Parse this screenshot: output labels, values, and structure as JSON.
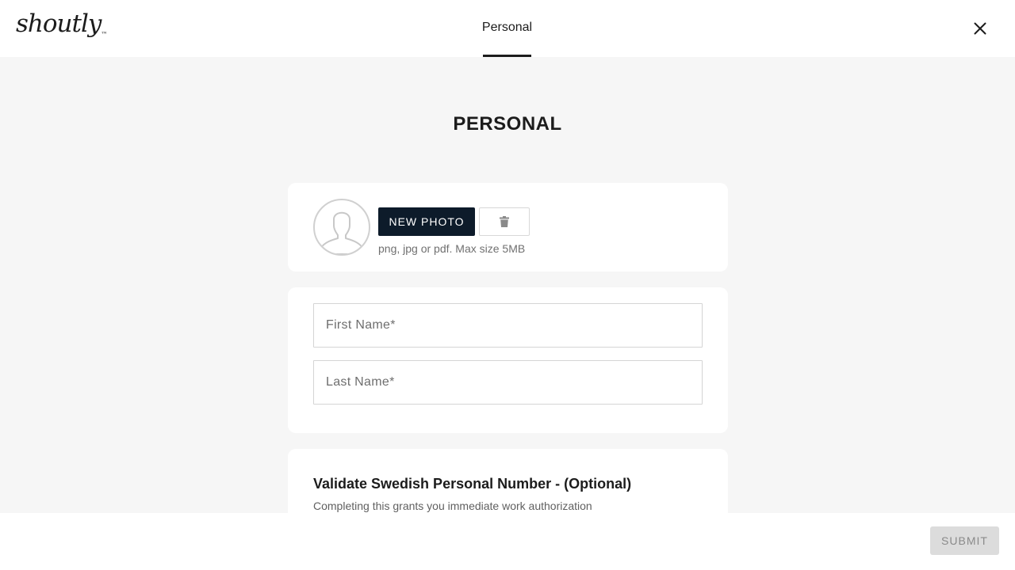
{
  "header": {
    "logo_text": "shoutly",
    "logo_mark": "™",
    "tab_label": "Personal",
    "close_icon": "close-icon"
  },
  "main": {
    "title": "PERSONAL",
    "photo": {
      "avatar_icon": "user-silhouette-icon",
      "new_photo_label": "NEW PHOTO",
      "delete_icon": "trash-icon",
      "hint": "png, jpg or pdf. Max size 5MB"
    },
    "names": {
      "first_name_placeholder": "First Name*",
      "first_name_value": "",
      "last_name_placeholder": "Last Name*",
      "last_name_value": ""
    },
    "personal_number": {
      "title": "Validate Swedish Personal Number - (Optional)",
      "subtitle": "Completing this grants you immediate work authorization"
    }
  },
  "footer": {
    "submit_label": "SUBMIT"
  },
  "colors": {
    "background": "#f6f6f6",
    "card": "#ffffff",
    "primary_button": "#0d1b2a",
    "disabled_button": "#dcdcdc"
  }
}
